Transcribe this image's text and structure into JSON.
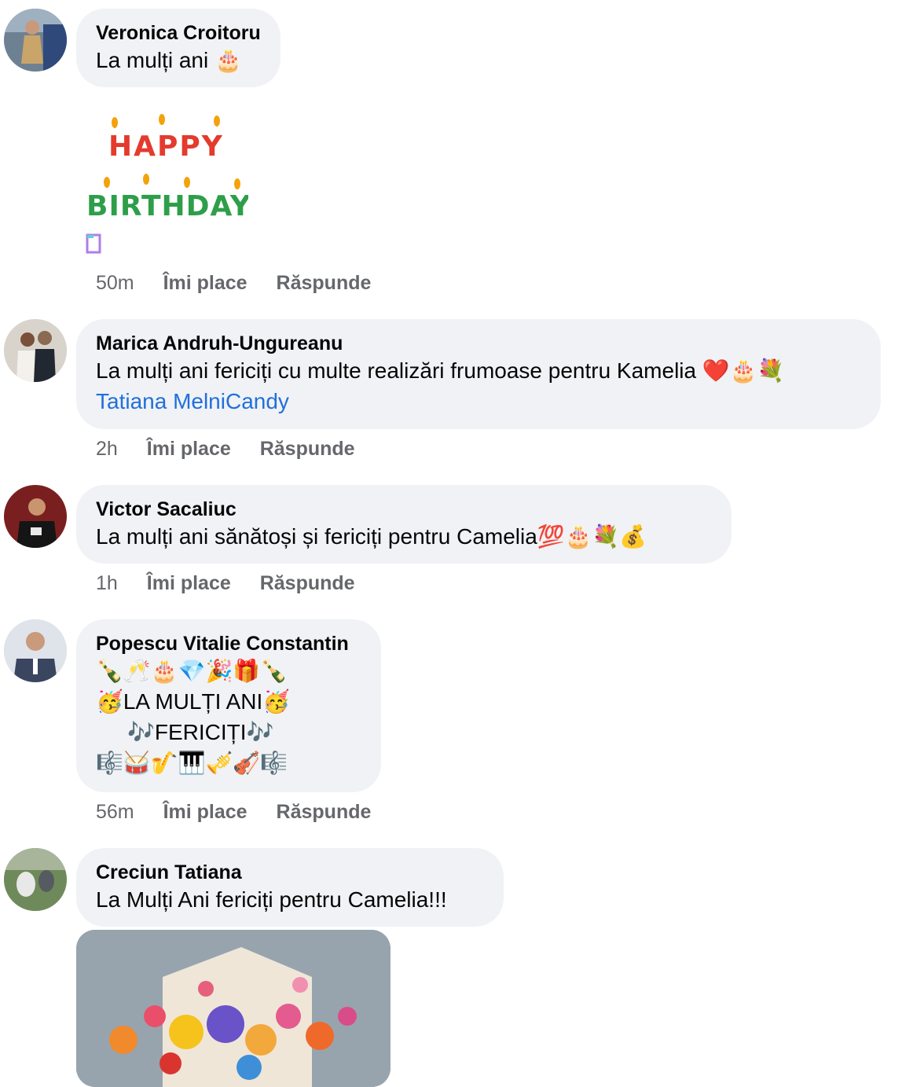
{
  "comments": [
    {
      "author": "Veronica Croitoru",
      "lines": [
        "La mulți ani 🎂"
      ],
      "sticker_text": [
        "HAPPY",
        "BIRTHDAY"
      ],
      "time": "50m",
      "like": "Îmi place",
      "reply": "Răspunde"
    },
    {
      "author": "Marica Andruh-Ungureanu",
      "lines": [
        "La mulți ani fericiți cu multe realizări frumoase pentru Kamelia ❤️🎂💐"
      ],
      "mention": "Tatiana MelniCandy",
      "time": "2h",
      "like": "Îmi place",
      "reply": "Răspunde"
    },
    {
      "author": "Victor Sacaliuc",
      "lines": [
        "La mulți ani sănătoși și fericiți pentru Camelia💯🎂💐💰"
      ],
      "time": "1h",
      "like": "Îmi place",
      "reply": "Răspunde"
    },
    {
      "author": "Popescu Vitalie Constantin",
      "lines": [
        "🍾🥂🎂💎🎉🎁🍾",
        "🥳LA MULȚI ANI🥳",
        "🎶FERICIȚI🎶",
        "🎼🥁🎷🎹🎺🎻🎼"
      ],
      "time": "56m",
      "like": "Îmi place",
      "reply": "Răspunde"
    },
    {
      "author": "Creciun Tatiana",
      "lines": [
        "La Mulți Ani fericiți pentru Camelia!!!"
      ]
    }
  ],
  "colors": {
    "bubble": "#f0f2f5",
    "link": "#216fdb",
    "meta": "#65676b"
  }
}
